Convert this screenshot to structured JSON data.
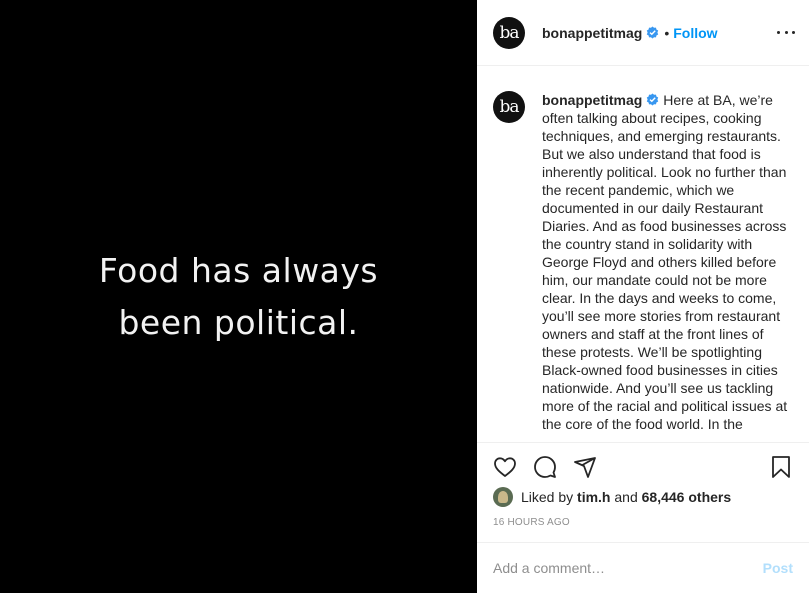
{
  "post_image": {
    "text": "Food has always\nbeen political."
  },
  "header": {
    "avatar_text": "ba",
    "username": "bonappetitmag",
    "separator": "•",
    "follow_label": "Follow"
  },
  "caption": {
    "avatar_text": "ba",
    "username": "bonappetitmag",
    "text": "Here at BA, we’re often talking about recipes, cooking techniques, and emerging restaurants. But we also understand that food is inherently political. Look no further than the recent pandemic, which we documented in our daily Restaurant Diaries. And as food businesses across the country stand in solidarity with George Floyd and others killed before him, our mandate could not be more clear. In the days and weeks to come, you’ll see more stories from restaurant owners and staff at the front lines of these protests. We’ll be spotlighting Black-owned food businesses in cities nationwide. And you’ll see us tackling more of the racial and political issues at the core of the food world. In the"
  },
  "likes": {
    "prefix": "Liked by",
    "user": "tim.h",
    "and": "and",
    "others": "68,446 others"
  },
  "timestamp": "16 HOURS AGO",
  "comment_box": {
    "placeholder": "Add a comment…",
    "post_label": "Post"
  },
  "colors": {
    "accent": "#0095f6",
    "verified": "#3897f0",
    "post_disabled": "#b2dffc",
    "muted": "#8e8e8e"
  },
  "icons": [
    "heart-icon",
    "comment-icon",
    "share-icon",
    "bookmark-icon",
    "verified-badge-icon",
    "more-options-icon"
  ]
}
